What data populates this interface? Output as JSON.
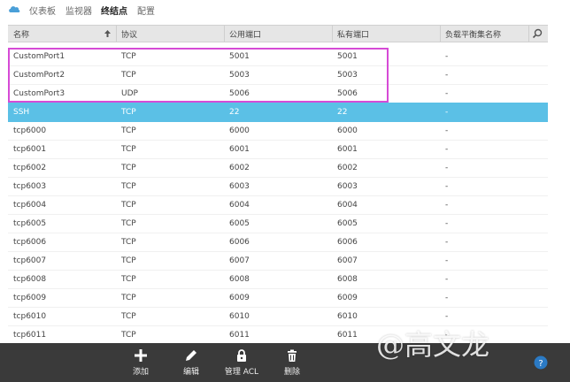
{
  "tabs": [
    {
      "label": "仪表板"
    },
    {
      "label": "监视器"
    },
    {
      "label": "终结点"
    },
    {
      "label": "配置"
    }
  ],
  "table": {
    "columns": [
      "名称",
      "协议",
      "公用端口",
      "私有端口",
      "负载平衡集名称"
    ],
    "rows": [
      {
        "name": "CustomPort1",
        "protocol": "TCP",
        "public": "5001",
        "private": "5001",
        "lbset": "-"
      },
      {
        "name": "CustomPort2",
        "protocol": "TCP",
        "public": "5003",
        "private": "5003",
        "lbset": "-"
      },
      {
        "name": "CustomPort3",
        "protocol": "UDP",
        "public": "5006",
        "private": "5006",
        "lbset": "-"
      },
      {
        "name": "SSH",
        "protocol": "TCP",
        "public": "22",
        "private": "22",
        "lbset": "-"
      },
      {
        "name": "tcp6000",
        "protocol": "TCP",
        "public": "6000",
        "private": "6000",
        "lbset": "-"
      },
      {
        "name": "tcp6001",
        "protocol": "TCP",
        "public": "6001",
        "private": "6001",
        "lbset": "-"
      },
      {
        "name": "tcp6002",
        "protocol": "TCP",
        "public": "6002",
        "private": "6002",
        "lbset": "-"
      },
      {
        "name": "tcp6003",
        "protocol": "TCP",
        "public": "6003",
        "private": "6003",
        "lbset": "-"
      },
      {
        "name": "tcp6004",
        "protocol": "TCP",
        "public": "6004",
        "private": "6004",
        "lbset": "-"
      },
      {
        "name": "tcp6005",
        "protocol": "TCP",
        "public": "6005",
        "private": "6005",
        "lbset": "-"
      },
      {
        "name": "tcp6006",
        "protocol": "TCP",
        "public": "6006",
        "private": "6006",
        "lbset": "-"
      },
      {
        "name": "tcp6007",
        "protocol": "TCP",
        "public": "6007",
        "private": "6007",
        "lbset": "-"
      },
      {
        "name": "tcp6008",
        "protocol": "TCP",
        "public": "6008",
        "private": "6008",
        "lbset": "-"
      },
      {
        "name": "tcp6009",
        "protocol": "TCP",
        "public": "6009",
        "private": "6009",
        "lbset": "-"
      },
      {
        "name": "tcp6010",
        "protocol": "TCP",
        "public": "6010",
        "private": "6010",
        "lbset": "-"
      },
      {
        "name": "tcp6011",
        "protocol": "TCP",
        "public": "6011",
        "private": "6011",
        "lbset": "-"
      }
    ],
    "selected_row": "SSH"
  },
  "commands": [
    {
      "label": "添加",
      "icon": "plus-icon"
    },
    {
      "label": "编辑",
      "icon": "pencil-icon"
    },
    {
      "label": "管理 ACL",
      "icon": "lock-icon"
    },
    {
      "label": "删除",
      "icon": "trash-icon"
    }
  ],
  "watermark": "@高文龙",
  "colors": {
    "selected_row": "#5bc0e6",
    "highlight_box": "#d64bd6",
    "command_bar": "#3a3a3a",
    "header_bg": "#e6e6e6"
  }
}
